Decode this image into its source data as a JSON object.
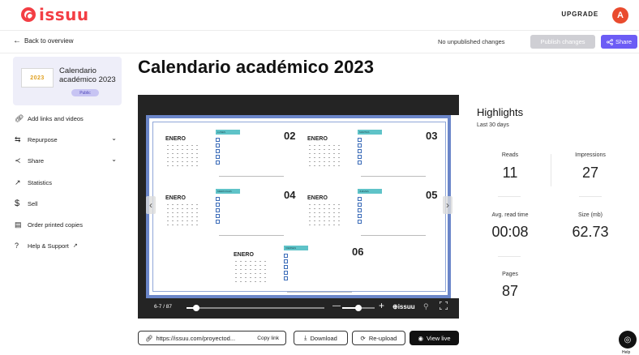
{
  "header": {
    "logo_text": "issuu",
    "upgrade_label": "UPGRADE",
    "avatar_initial": "A",
    "brand_color": "#f33e44"
  },
  "subbar": {
    "back_label": "Back to overview",
    "status_text": "No unpublished changes",
    "publish_label": "Publish changes",
    "share_label": "Share",
    "accent_color": "#6c5cf5"
  },
  "sidebar": {
    "doc_title": "Calendario académico 2023",
    "thumb_text": "2023",
    "badge": "Public",
    "items": [
      {
        "label": "Add links and videos",
        "icon": "link-icon"
      },
      {
        "label": "Repurpose",
        "icon": "repurpose-icon",
        "expandable": true
      },
      {
        "label": "Share",
        "icon": "share-icon",
        "expandable": true
      },
      {
        "label": "Statistics",
        "icon": "statistics-icon"
      },
      {
        "label": "Sell",
        "icon": "dollar-icon"
      },
      {
        "label": "Order printed copies",
        "icon": "print-icon"
      },
      {
        "label": "Help & Support",
        "icon": "help-icon",
        "external": true
      }
    ]
  },
  "main": {
    "title": "Calendario académico 2023"
  },
  "viewer": {
    "page_indicator": "6-7 / 87",
    "progress": 0.07,
    "zoom_level": 0.5,
    "brand": "issuu",
    "calendar_blocks": [
      {
        "month": "ENERO",
        "tag": "LUNES",
        "number": "02"
      },
      {
        "month": "ENERO",
        "tag": "MARTES",
        "number": "03"
      },
      {
        "month": "ENERO",
        "tag": "MIERCOLES",
        "number": "04"
      },
      {
        "month": "ENERO",
        "tag": "JUEVES",
        "number": "05"
      },
      {
        "month": "ENERO",
        "tag": "VIERNES",
        "number": "06"
      }
    ]
  },
  "actions": {
    "url": "https://issuu.com/proyectod...",
    "copy_link": "Copy link",
    "download": "Download",
    "reupload": "Re-upload",
    "view_live": "View live"
  },
  "highlights": {
    "title": "Highlights",
    "period": "Last 30 days",
    "stats": [
      {
        "label": "Reads",
        "value": "11"
      },
      {
        "label": "Impressions",
        "value": "27"
      },
      {
        "label": "Avg. read time",
        "value": "00:08"
      },
      {
        "label": "Size (mb)",
        "value": "62.73"
      },
      {
        "label": "Pages",
        "value": "87"
      }
    ]
  },
  "help_widget": {
    "label": "Help"
  }
}
